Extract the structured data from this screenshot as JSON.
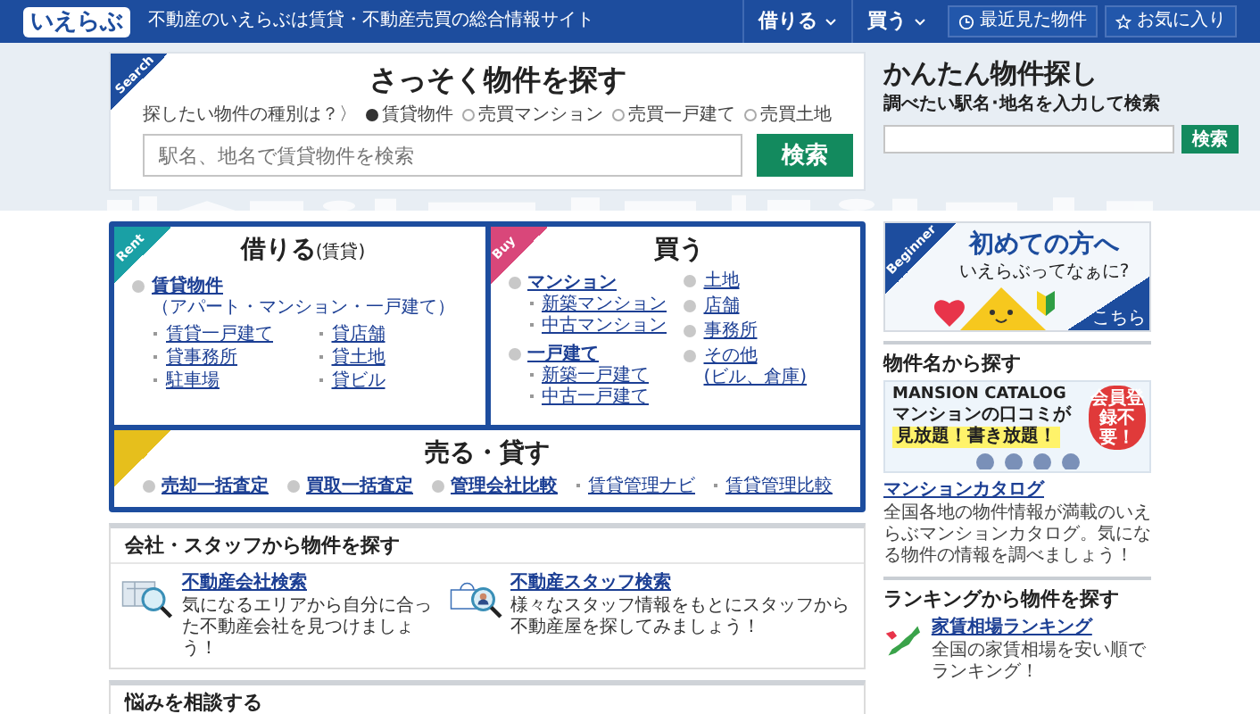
{
  "header": {
    "logo": "いえらぶ",
    "tagline": "不動産のいえらぶは賃貸・不動産売買の総合情報サイト",
    "nav": [
      {
        "label": "借りる"
      },
      {
        "label": "買う"
      }
    ],
    "buttons": [
      {
        "kind": "history",
        "label": "最近見た物件"
      },
      {
        "kind": "favorite",
        "label": "お気に入り"
      }
    ]
  },
  "search": {
    "ribbon": "Search",
    "title": "さっそく物件を探す",
    "prompt": "探したい物件の種別は？〉",
    "options": [
      {
        "label": "賃貸物件",
        "selected": true
      },
      {
        "label": "売買マンション",
        "selected": false
      },
      {
        "label": "売買一戸建て",
        "selected": false
      },
      {
        "label": "売買土地",
        "selected": false
      }
    ],
    "placeholder": "駅名、地名で賃貸物件を検索",
    "button": "検索"
  },
  "quick_search": {
    "title": "かんたん物件探し",
    "subtitle": "調べたい駅名･地名を入力して検索",
    "button": "検索"
  },
  "rent": {
    "ribbon": "Rent",
    "title": "借りる",
    "title_note": "(賃貸)",
    "main_link": "賃貸物件",
    "main_note": "（アパート・マンション・一戸建て）",
    "links": [
      "賃貸一戸建て",
      "貸店舗",
      "貸事務所",
      "貸土地",
      "駐車場",
      "貸ビル"
    ]
  },
  "buy": {
    "ribbon": "Buy",
    "title": "買う",
    "groups": [
      {
        "label": "マンション",
        "children": [
          "新築マンション",
          "中古マンション"
        ]
      },
      {
        "label": "一戸建て",
        "children": [
          "新築一戸建て",
          "中古一戸建て"
        ]
      }
    ],
    "others": [
      {
        "label": "土地"
      },
      {
        "label": "店舗"
      },
      {
        "label": "事務所"
      },
      {
        "label": "その他",
        "note": "(ビル、倉庫)"
      }
    ]
  },
  "sell": {
    "title": "売る・貸す",
    "links": [
      {
        "kind": "main",
        "label": "売却一括査定"
      },
      {
        "kind": "main",
        "label": "買取一括査定"
      },
      {
        "kind": "main",
        "label": "管理会社比較"
      },
      {
        "kind": "sub",
        "label": "賃貸管理ナビ"
      },
      {
        "kind": "sub",
        "label": "賃貸管理比較"
      }
    ]
  },
  "company": {
    "title": "会社・スタッフから物件を探す",
    "items": [
      {
        "kind": "company",
        "title": "不動産会社検索",
        "desc": "気になるエリアから自分に合った不動産会社を見つけましょう！"
      },
      {
        "kind": "staff",
        "title": "不動産スタッフ検索",
        "desc": "様々なスタッフ情報をもとにスタッフから不動産屋を探してみましょう！"
      }
    ]
  },
  "consult": {
    "title": "悩みを相談する"
  },
  "sidebar": {
    "beginner": {
      "ribbon": "Beginner",
      "title": "初めての方へ",
      "subtitle": "いえらぶってなぁに?",
      "corner": "こちら"
    },
    "name_search": {
      "title": "物件名から探す",
      "banner_title": "MANSION CATALOG",
      "banner_line": "マンションの口コミが",
      "banner_highlight": "見放題！書き放題！",
      "banner_badge": "会員登録不要！",
      "link": "マンションカタログ",
      "desc": "全国各地の物件情報が満載のいえらぶマンションカタログ。気になる物件の情報を調べましょう！"
    },
    "ranking": {
      "title": "ランキングから物件を探す",
      "link": "家賃相場ランキング",
      "desc": "全国の家賃相場を安い順でランキング！"
    }
  }
}
